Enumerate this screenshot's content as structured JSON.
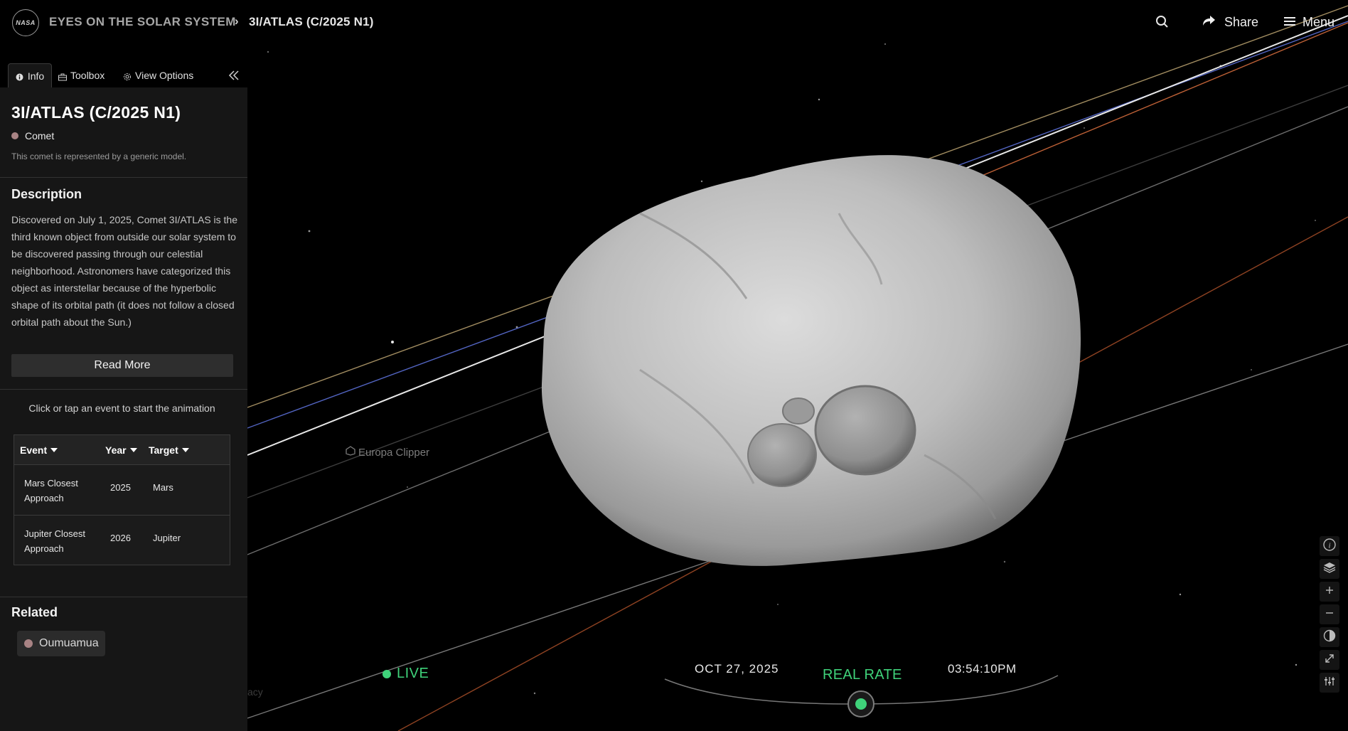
{
  "header": {
    "logo_text": "NASA",
    "breadcrumb_home": "EYES ON THE SOLAR SYSTEM",
    "breadcrumb_separator": "›",
    "breadcrumb_current": "3I/ATLAS (C/2025 N1)",
    "search_icon": "search-icon",
    "share_label": "Share",
    "menu_label": "Menu"
  },
  "sidebar": {
    "tabs": [
      {
        "label": "Info",
        "icon": "info-icon",
        "active": true
      },
      {
        "label": "Toolbox",
        "icon": "toolbox-icon",
        "active": false
      },
      {
        "label": "View Options",
        "icon": "gear-icon",
        "active": false
      }
    ],
    "collapse_icon": "double-chevron-left-icon",
    "title": "3I/ATLAS (C/2025 N1)",
    "type_label": "Comet",
    "type_color": "#a88384",
    "model_note": "This comet is represented by a generic model.",
    "description_heading": "Description",
    "description_text": "Discovered on July 1, 2025, Comet 3I/ATLAS is the third known object from outside our solar system to be discovered passing through our celestial neighborhood. Astronomers have categorized this object as interstellar because of the hyperbolic shape of its orbital path (it does not follow a closed orbital path about the Sun.)",
    "read_more_label": "Read More",
    "events_hint": "Click or tap an event to start the animation",
    "events_table": {
      "headers": [
        "Event",
        "Year",
        "Target"
      ],
      "rows": [
        {
          "event": "Mars Closest Approach",
          "year": "2025",
          "target": "Mars"
        },
        {
          "event": "Jupiter Closest Approach",
          "year": "2026",
          "target": "Jupiter"
        }
      ]
    },
    "related_heading": "Related",
    "related_items": [
      {
        "label": "Oumuamua",
        "color": "#a88384"
      }
    ]
  },
  "scene": {
    "label": "Europa Clipper",
    "faint_label": "acy"
  },
  "time_controls": {
    "live_label": "LIVE",
    "date": "OCT 27, 2025",
    "rate_label": "REAL RATE",
    "time": "03:54:10PM",
    "accent_color": "#3fd27a"
  },
  "tools": [
    {
      "icon": "info-circle-icon"
    },
    {
      "icon": "layers-icon"
    },
    {
      "icon": "plus-icon"
    },
    {
      "icon": "minus-icon"
    },
    {
      "icon": "contrast-icon"
    },
    {
      "icon": "expand-icon"
    },
    {
      "icon": "sliders-icon"
    }
  ]
}
